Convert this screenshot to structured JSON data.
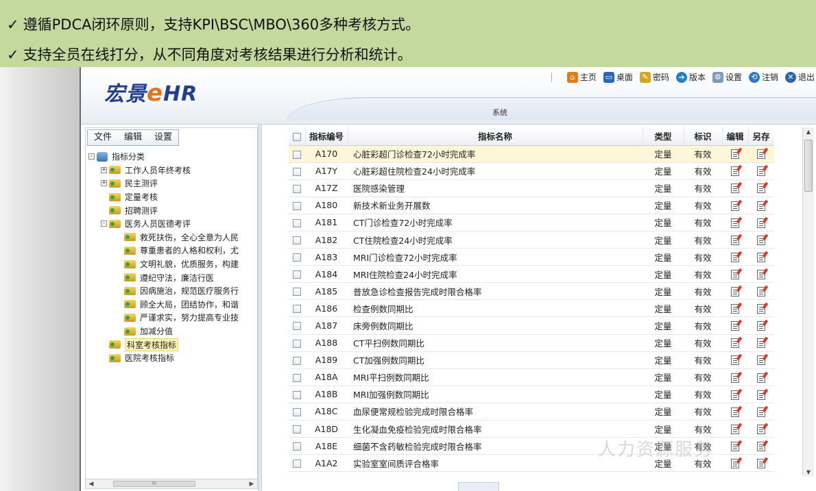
{
  "banner": {
    "check_icon": "✓",
    "line1": "遵循PDCA闭环原则，支持KPI\\BSC\\MBO\\360多种考核方式。",
    "line2": "支持全员在线打分，从不同角度对考核结果进行分析和统计。"
  },
  "app": {
    "logo_text": "宏景",
    "logo_e": "e",
    "logo_hr": "HR",
    "sys_label": "系统",
    "topnav": [
      {
        "label": "主页",
        "icon": "home-icon"
      },
      {
        "label": "桌面",
        "icon": "desktop-icon"
      },
      {
        "label": "密码",
        "icon": "password-icon"
      },
      {
        "label": "版本",
        "icon": "version-icon"
      },
      {
        "label": "设置",
        "icon": "settings-icon"
      },
      {
        "label": "注销",
        "icon": "logout-icon"
      },
      {
        "label": "退出",
        "icon": "exit-icon"
      }
    ]
  },
  "left_panel": {
    "menu": [
      "文件",
      "编辑",
      "设置"
    ],
    "tree": [
      {
        "label": "指标分类",
        "level": 0,
        "expander": "-",
        "type": "root"
      },
      {
        "label": "工作人员年终考核",
        "level": 1,
        "expander": "+"
      },
      {
        "label": "民主测评",
        "level": 1,
        "expander": "+"
      },
      {
        "label": "定量考核",
        "level": 1,
        "expander": ""
      },
      {
        "label": "招聘测评",
        "level": 1,
        "expander": ""
      },
      {
        "label": "医务人员医德考评",
        "level": 1,
        "expander": "-"
      },
      {
        "label": "救死扶伤，全心全意为人民",
        "level": 2,
        "expander": ""
      },
      {
        "label": "尊重患者的人格和权利，尤",
        "level": 2,
        "expander": ""
      },
      {
        "label": "文明礼貌，优质服务，构建",
        "level": 2,
        "expander": ""
      },
      {
        "label": "遵纪守法，廉洁行医",
        "level": 2,
        "expander": ""
      },
      {
        "label": "因病施治，规范医疗服务行",
        "level": 2,
        "expander": ""
      },
      {
        "label": "顾全大局，团结协作，和谐",
        "level": 2,
        "expander": ""
      },
      {
        "label": "严谨求实，努力提高专业技",
        "level": 2,
        "expander": ""
      },
      {
        "label": "加减分值",
        "level": 2,
        "expander": ""
      },
      {
        "label": "科室考核指标",
        "level": 1,
        "expander": "",
        "selected": true
      },
      {
        "label": "医院考核指标",
        "level": 1,
        "expander": ""
      }
    ],
    "scroll_thumb": "III"
  },
  "grid": {
    "columns": [
      "指标编号",
      "指标名称",
      "类型",
      "标识",
      "编辑",
      "另存"
    ],
    "rows": [
      {
        "code": "A170",
        "name": "心脏彩超门诊检查72小时完成率",
        "type": "定量",
        "flag": "有效",
        "highlight": true
      },
      {
        "code": "A17Y",
        "name": "心脏彩超住院检查24小时完成率",
        "type": "定量",
        "flag": "有效"
      },
      {
        "code": "A17Z",
        "name": "医院感染管理",
        "type": "定量",
        "flag": "有效"
      },
      {
        "code": "A180",
        "name": "新技术新业务开展数",
        "type": "定量",
        "flag": "有效"
      },
      {
        "code": "A181",
        "name": "CT门诊检查72小时完成率",
        "type": "定量",
        "flag": "有效"
      },
      {
        "code": "A182",
        "name": "CT住院检查24小时完成率",
        "type": "定量",
        "flag": "有效"
      },
      {
        "code": "A183",
        "name": "MRI门诊检查72小时完成率",
        "type": "定量",
        "flag": "有效"
      },
      {
        "code": "A184",
        "name": "MRI住院检查24小时完成率",
        "type": "定量",
        "flag": "有效"
      },
      {
        "code": "A185",
        "name": "普放急诊检查报告完成时限合格率",
        "type": "定量",
        "flag": "有效"
      },
      {
        "code": "A186",
        "name": "检查例数同期比",
        "type": "定量",
        "flag": "有效"
      },
      {
        "code": "A187",
        "name": "床旁例数同期比",
        "type": "定量",
        "flag": "有效"
      },
      {
        "code": "A188",
        "name": "CT平扫例数同期比",
        "type": "定量",
        "flag": "有效"
      },
      {
        "code": "A189",
        "name": "CT加强例数同期比",
        "type": "定量",
        "flag": "有效"
      },
      {
        "code": "A18A",
        "name": "MRI平扫例数同期比",
        "type": "定量",
        "flag": "有效"
      },
      {
        "code": "A18B",
        "name": "MRI加强例数同期比",
        "type": "定量",
        "flag": "有效"
      },
      {
        "code": "A18C",
        "name": "血尿便常规检验完成时限合格率",
        "type": "定量",
        "flag": "有效"
      },
      {
        "code": "A18D",
        "name": "生化凝血免疫检验完成时限合格率",
        "type": "定量",
        "flag": "有效"
      },
      {
        "code": "A18E",
        "name": "细菌不含药敏检验完成时限合格率",
        "type": "定量",
        "flag": "有效"
      },
      {
        "code": "A1A2",
        "name": "实验室室间质评合格率",
        "type": "定量",
        "flag": "有效"
      }
    ]
  },
  "watermark": "人力资源服务"
}
